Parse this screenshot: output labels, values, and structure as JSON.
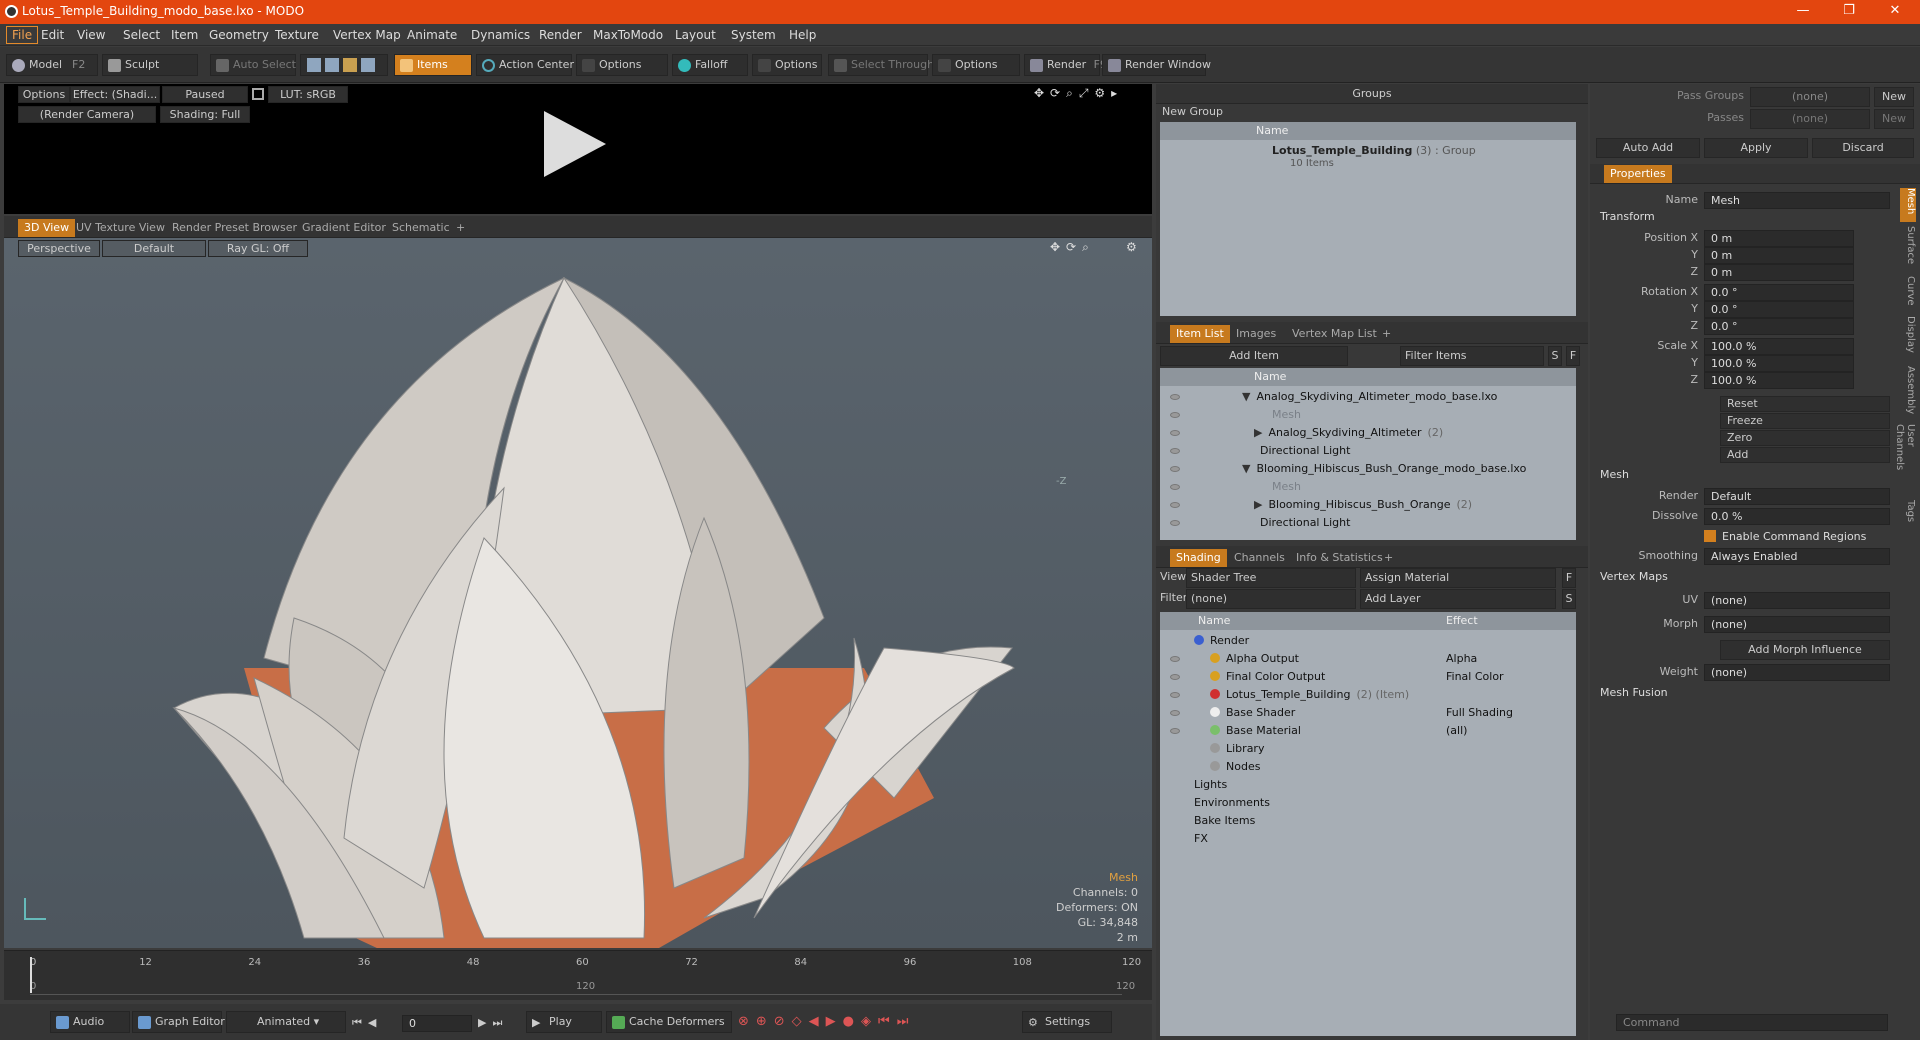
{
  "window": {
    "title": "Lotus_Temple_Building_modo_base.lxo - MODO",
    "minimize": "—",
    "restore": "❐",
    "close": "✕"
  },
  "menu": [
    "File",
    "Edit",
    "View",
    "Select",
    "Item",
    "Geometry",
    "Texture",
    "Vertex Map",
    "Animate",
    "Dynamics",
    "Render",
    "MaxToModo",
    "Layout",
    "System",
    "Help"
  ],
  "toolbar": {
    "model": "Model",
    "model_key": "F2",
    "sculpt": "Sculpt",
    "auto_select": "Auto Select",
    "items": "Items",
    "action_center": "Action Center",
    "options1": "Options",
    "falloff": "Falloff",
    "options2": "Options",
    "select_through": "Select Through",
    "options3": "Options",
    "render": "Render",
    "render_key": "F9",
    "render_window": "Render Window"
  },
  "preview": {
    "options": "Options",
    "effect": "Effect: (Shadi...",
    "paused": "Paused",
    "lut": "LUT: sRGB",
    "camera": "(Render Camera)",
    "shading": "Shading: Full"
  },
  "viewport": {
    "tabs": [
      "3D View",
      "UV Texture View",
      "Render Preset Browser",
      "Gradient Editor",
      "Schematic",
      "+"
    ],
    "perspective": "Perspective",
    "default": "Default",
    "raygl": "Ray GL: Off",
    "z_label": "-Z",
    "stats": {
      "mesh": "Mesh",
      "channels": "Channels: 0",
      "deformers": "Deformers: ON",
      "gl": "GL: 34,848",
      "scale": "2 m"
    }
  },
  "timeline": {
    "ticks": [
      "0",
      "12",
      "24",
      "36",
      "48",
      "60",
      "72",
      "84",
      "96",
      "108",
      "120"
    ],
    "sub_ticks": [
      "0",
      "120",
      "120"
    ]
  },
  "bottombar": {
    "audio": "Audio",
    "graph_editor": "Graph Editor",
    "animated": "Animated",
    "frame": "0",
    "play": "Play",
    "cache": "Cache Deformers",
    "settings": "Settings"
  },
  "groups": {
    "header": "Groups",
    "new_group": "New Group",
    "col_name": "Name",
    "item": "Lotus_Temple_Building",
    "item_count": "(3)",
    "item_type": ": Group",
    "sub": "10 Items"
  },
  "itemlist": {
    "tabs": [
      "Item List",
      "Images",
      "Vertex Map List",
      "+"
    ],
    "add_item": "Add Item",
    "filter": "Filter Items",
    "s": "S",
    "f": "F",
    "col_name": "Name",
    "rows": [
      {
        "label": "Analog_Skydiving_Altimeter_modo_base.lxo",
        "indent": 0,
        "exp": "▼",
        "dim": false
      },
      {
        "label": "Mesh",
        "indent": 2,
        "exp": "",
        "dim": true
      },
      {
        "label": "Analog_Skydiving_Altimeter",
        "indent": 1,
        "exp": "▶",
        "dim": false,
        "suffix": "(2)"
      },
      {
        "label": "Directional Light",
        "indent": 1,
        "exp": "",
        "dim": false
      },
      {
        "label": "Blooming_Hibiscus_Bush_Orange_modo_base.lxo",
        "indent": 0,
        "exp": "▼",
        "dim": false
      },
      {
        "label": "Mesh",
        "indent": 2,
        "exp": "",
        "dim": true
      },
      {
        "label": "Blooming_Hibiscus_Bush_Orange",
        "indent": 1,
        "exp": "▶",
        "dim": false,
        "suffix": "(2)"
      },
      {
        "label": "Directional Light",
        "indent": 1,
        "exp": "",
        "dim": false
      }
    ]
  },
  "shading": {
    "tabs": [
      "Shading",
      "Channels",
      "Info & Statistics",
      "+"
    ],
    "view_lbl": "View",
    "view": "Shader Tree",
    "assign": "Assign Material",
    "f": "F",
    "filter_lbl": "Filter",
    "filter": "(none)",
    "add_layer": "Add Layer",
    "s": "S",
    "col_name": "Name",
    "col_effect": "Effect",
    "rows": [
      {
        "label": "Render",
        "effect": "",
        "indent": 0,
        "eye": false
      },
      {
        "label": "Alpha Output",
        "effect": "Alpha",
        "indent": 1,
        "eye": true
      },
      {
        "label": "Final Color Output",
        "effect": "Final Color",
        "indent": 1,
        "eye": true
      },
      {
        "label": "Lotus_Temple_Building",
        "effect": "",
        "indent": 1,
        "eye": true,
        "suffix": "(2) (Item)"
      },
      {
        "label": "Base Shader",
        "effect": "Full Shading",
        "indent": 1,
        "eye": true
      },
      {
        "label": "Base Material",
        "effect": "(all)",
        "indent": 1,
        "eye": true
      },
      {
        "label": "Library",
        "effect": "",
        "indent": 1,
        "eye": false
      },
      {
        "label": "Nodes",
        "effect": "",
        "indent": 1,
        "eye": false
      },
      {
        "label": "Lights",
        "effect": "",
        "indent": 0,
        "eye": false
      },
      {
        "label": "Environments",
        "effect": "",
        "indent": 0,
        "eye": false
      },
      {
        "label": "Bake Items",
        "effect": "",
        "indent": 0,
        "eye": false
      },
      {
        "label": "FX",
        "effect": "",
        "indent": 0,
        "eye": false
      }
    ]
  },
  "props": {
    "pass_groups": "Pass Groups",
    "passes": "Passes",
    "none": "(none)",
    "new": "New",
    "auto_add": "Auto Add",
    "apply": "Apply",
    "discard": "Discard",
    "tab": "Properties",
    "name_lbl": "Name",
    "name": "Mesh",
    "transform": "Transform",
    "pos_x": "Position X",
    "y": "Y",
    "z": "Z",
    "rot_x": "Rotation X",
    "scale_x": "Scale X",
    "pos_vals": [
      "0 m",
      "0 m",
      "0 m"
    ],
    "rot_vals": [
      "0.0 °",
      "0.0 °",
      "0.0 °"
    ],
    "scale_vals": [
      "100.0 %",
      "100.0 %",
      "100.0 %"
    ],
    "reset": "Reset",
    "freeze": "Freeze",
    "zero": "Zero",
    "add": "Add",
    "mesh": "Mesh",
    "render_lbl": "Render",
    "render": "Default",
    "dissolve_lbl": "Dissolve",
    "dissolve": "0.0 %",
    "ecr": "Enable Command Regions",
    "smoothing_lbl": "Smoothing",
    "smoothing": "Always Enabled",
    "vertex_maps": "Vertex Maps",
    "uv_lbl": "UV",
    "uv": "(none)",
    "morph_lbl": "Morph",
    "morph": "(none)",
    "add_morph": "Add Morph Influence",
    "weight_lbl": "Weight",
    "weight": "(none)",
    "mesh_fusion": "Mesh Fusion",
    "side_tabs": [
      "Mesh",
      "Surface",
      "Curve",
      "Display",
      "Assembly",
      "User Channels",
      "Tags"
    ],
    "command": "Command"
  },
  "colors": {
    "accent": "#e3460f",
    "orange": "#d4801e",
    "bg": "#3a3a3a"
  }
}
